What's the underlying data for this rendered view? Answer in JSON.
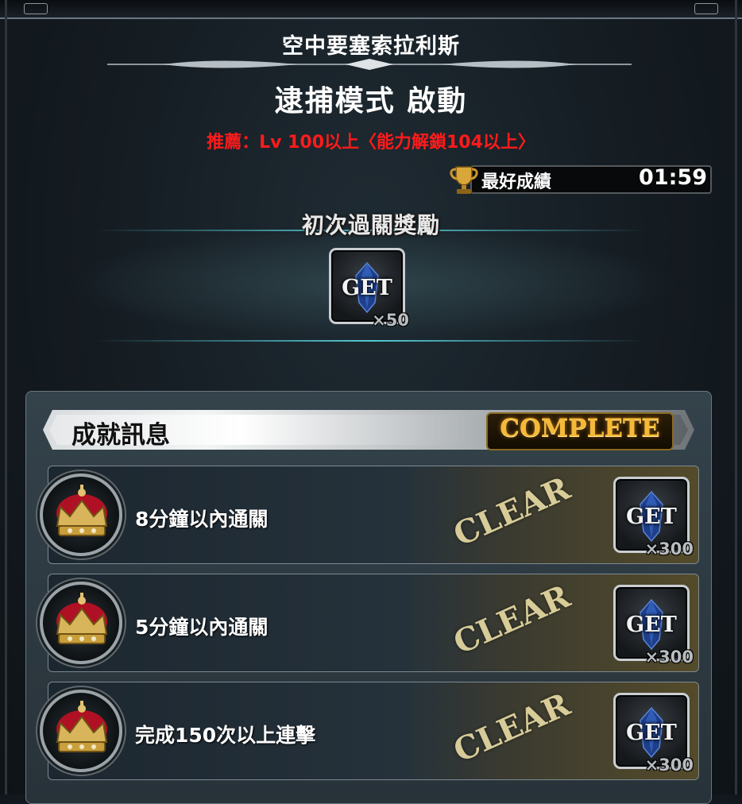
{
  "stage": {
    "name": "空中要塞索拉利斯",
    "mode_title": "逮捕模式 啟動",
    "recommendation": "推薦：Lv 100以上〈能力解鎖104以上〉"
  },
  "best_record": {
    "label": "最好成績",
    "time": "01:59"
  },
  "first_clear_reward": {
    "title": "初次過關獎勵",
    "tile_text": "GET",
    "quantity": "×50"
  },
  "achievements": {
    "title": "成就訊息",
    "status": "COMPLETE",
    "items": [
      {
        "label": "8分鐘以內通關",
        "stamp": "CLEAR",
        "reward_text": "GET",
        "reward_qty": "×300"
      },
      {
        "label": "5分鐘以內通關",
        "stamp": "CLEAR",
        "reward_text": "GET",
        "reward_qty": "×300"
      },
      {
        "label": "完成150次以上連擊",
        "stamp": "CLEAR",
        "reward_text": "GET",
        "reward_qty": "×300"
      }
    ]
  },
  "icons": [
    "trophy-icon",
    "crystal-icon",
    "crown-icon"
  ],
  "colors": {
    "recommend_red": "#ff1b1b",
    "complete_gold": "#f5b938",
    "band_cyan": "#5adce6"
  }
}
